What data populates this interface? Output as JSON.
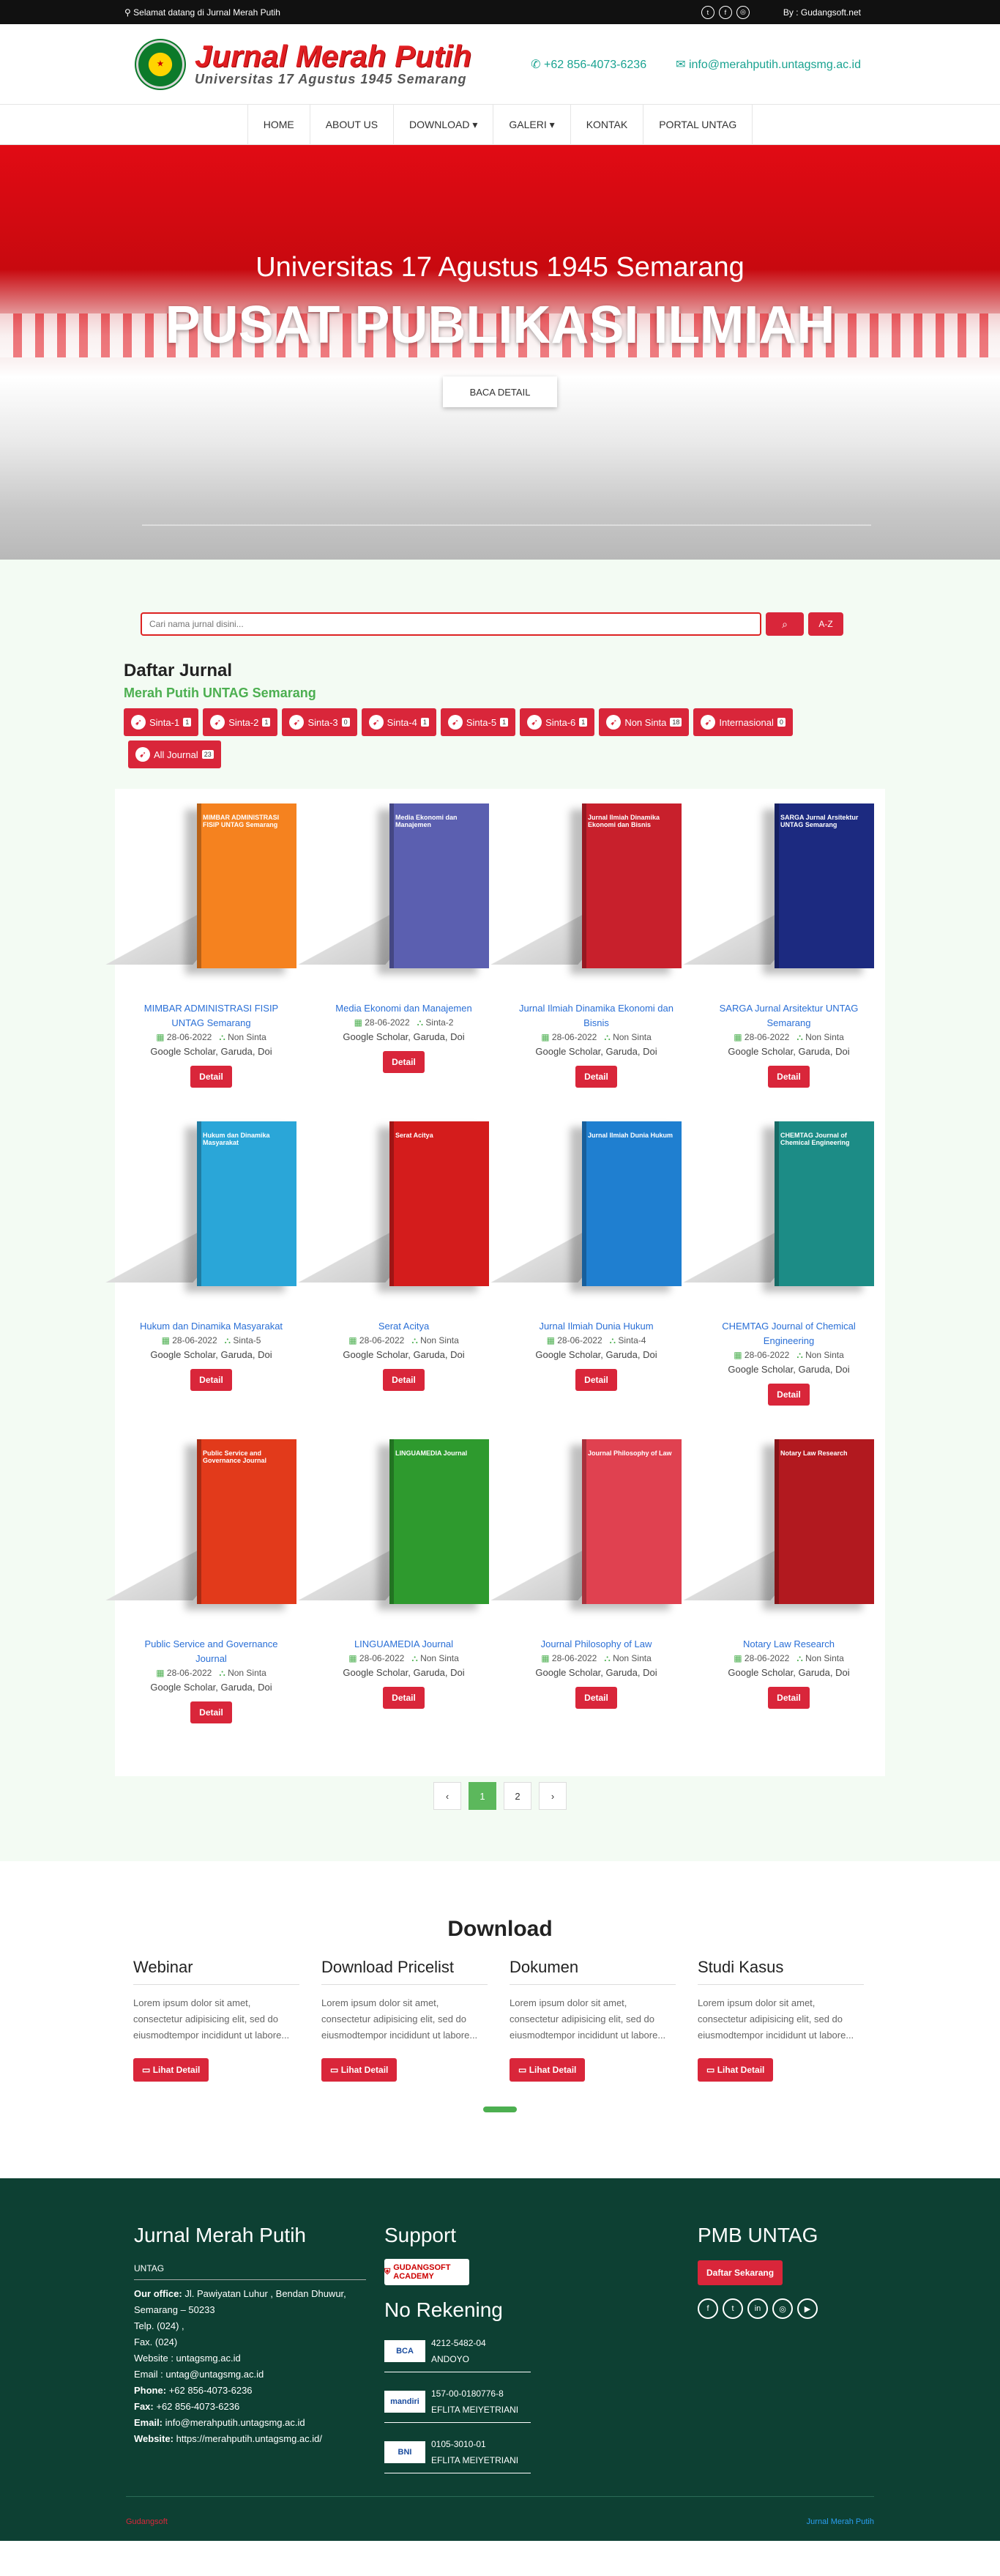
{
  "topbar": {
    "welcome": "Selamat datang di Jurnal Merah Putih",
    "credit": "By : Gudangsoft.net",
    "socials": [
      "twitter",
      "facebook",
      "instagram"
    ]
  },
  "header": {
    "title": "Jurnal Merah Putih",
    "subtitle": "Universitas 17 Agustus 1945 Semarang",
    "phone": "+62 856-4073-6236",
    "email": "info@merahputih.untagsmg.ac.id"
  },
  "nav": {
    "items": [
      "HOME",
      "ABOUT US",
      "DOWNLOAD ▾",
      "GALERI ▾",
      "KONTAK",
      "PORTAL UNTAG"
    ]
  },
  "hero": {
    "subtitle": "Universitas 17 Agustus 1945 Semarang",
    "title": "PUSAT PUBLIKASI ILMIAH",
    "button": "BACA DETAIL"
  },
  "search": {
    "placeholder": "Cari nama jurnal disini...",
    "az": "A-Z"
  },
  "list": {
    "title": "Daftar Jurnal",
    "subtitle": "Merah Putih UNTAG Semarang"
  },
  "filters": [
    {
      "label": "Sinta-1",
      "count": "1"
    },
    {
      "label": "Sinta-2",
      "count": "1"
    },
    {
      "label": "Sinta-3",
      "count": "0"
    },
    {
      "label": "Sinta-4",
      "count": "1"
    },
    {
      "label": "Sinta-5",
      "count": "1"
    },
    {
      "label": "Sinta-6",
      "count": "1"
    },
    {
      "label": "Non Sinta",
      "count": "18"
    },
    {
      "label": "Internasional",
      "count": "0"
    },
    {
      "label": "All Journal",
      "count": "23"
    }
  ],
  "journals": [
    {
      "name": "MIMBAR ADMINISTRASI FISIP UNTAG Semarang",
      "date": "28-06-2022",
      "sinta": "Non Sinta",
      "index": "Google Scholar, Garuda, Doi",
      "color": "#f5821f"
    },
    {
      "name": "Media Ekonomi dan Manajemen",
      "date": "28-06-2022",
      "sinta": "Sinta-2",
      "index": "Google Scholar, Garuda, Doi",
      "color": "#5b5fb0"
    },
    {
      "name": "Jurnal Ilmiah Dinamika Ekonomi dan Bisnis",
      "date": "28-06-2022",
      "sinta": "Non Sinta",
      "index": "Google Scholar, Garuda, Doi",
      "color": "#c8202c"
    },
    {
      "name": "SARGA Jurnal Arsitektur UNTAG Semarang",
      "date": "28-06-2022",
      "sinta": "Non Sinta",
      "index": "Google Scholar, Garuda, Doi",
      "color": "#1c2a80"
    },
    {
      "name": "Hukum dan Dinamika Masyarakat",
      "date": "28-06-2022",
      "sinta": "Sinta-5",
      "index": "Google Scholar, Garuda, Doi",
      "color": "#2aa6d8"
    },
    {
      "name": "Serat Acitya",
      "date": "28-06-2022",
      "sinta": "Non Sinta",
      "index": "Google Scholar, Garuda, Doi",
      "color": "#d41c1c"
    },
    {
      "name": "Jurnal Ilmiah Dunia Hukum",
      "date": "28-06-2022",
      "sinta": "Sinta-4",
      "index": "Google Scholar, Garuda, Doi",
      "color": "#1f7fd0"
    },
    {
      "name": "CHEMTAG Journal of Chemical Engineering",
      "date": "28-06-2022",
      "sinta": "Non Sinta",
      "index": "Google Scholar, Garuda, Doi",
      "color": "#1c8c86"
    },
    {
      "name": "Public Service and Governance Journal",
      "date": "28-06-2022",
      "sinta": "Non Sinta",
      "index": "Google Scholar, Garuda, Doi",
      "color": "#e23a1b"
    },
    {
      "name": "LINGUAMEDIA Journal",
      "date": "28-06-2022",
      "sinta": "Non Sinta",
      "index": "Google Scholar, Garuda, Doi",
      "color": "#2e9a2e"
    },
    {
      "name": "Journal Philosophy of Law",
      "date": "28-06-2022",
      "sinta": "Non Sinta",
      "index": "Google Scholar, Garuda, Doi",
      "color": "#e04150"
    },
    {
      "name": "Notary Law Research",
      "date": "28-06-2022",
      "sinta": "Non Sinta",
      "index": "Google Scholar, Garuda, Doi",
      "color": "#b2191f"
    }
  ],
  "detail_label": "Detail",
  "pagination": {
    "prev": "‹",
    "pages": [
      "1",
      "2"
    ],
    "next": "›",
    "active": "1"
  },
  "download": {
    "title": "Download",
    "button": "Lihat Detail",
    "items": [
      {
        "title": "Webinar",
        "text": "Lorem ipsum dolor sit amet, consectetur adipisicing elit, sed do eiusmodtempor incididunt ut labore..."
      },
      {
        "title": "Download Pricelist",
        "text": "Lorem ipsum dolor sit amet, consectetur adipisicing elit, sed do eiusmodtempor incididunt ut labore..."
      },
      {
        "title": "Dokumen",
        "text": "Lorem ipsum dolor sit amet, consectetur adipisicing elit, sed do eiusmodtempor incididunt ut labore..."
      },
      {
        "title": "Studi Kasus",
        "text": "Lorem ipsum dolor sit amet, consectetur adipisicing elit, sed do eiusmodtempor incididunt ut labore..."
      }
    ]
  },
  "footer": {
    "title": "Jurnal Merah Putih",
    "org": "UNTAG",
    "office_label": "Our office:",
    "office": "Jl. Pawiyatan Luhur , Bendan Dhuwur, Semarang – 50233",
    "telp": "Telp. (024) ,",
    "fax1": "Fax. (024)",
    "website1": "Website : untagsmg.ac.id",
    "email1": "Email : untag@untagsmg.ac.id",
    "phone_label": "Phone:",
    "phone": "+62 856-4073-6236",
    "fax_label": "Fax:",
    "fax": "+62 856-4073-6236",
    "email_label": "Email:",
    "email": "info@merahputih.untagsmg.ac.id",
    "website_label": "Website:",
    "website": "https://merahputih.untagsmg.ac.id/",
    "support_title": "Support",
    "support_logo": "GUDANGSOFT ACADEMY",
    "rekening_title": "No Rekening",
    "rekening": [
      {
        "bank": "BCA",
        "number": "4212-5482-04",
        "name": "ANDOYO"
      },
      {
        "bank": "mandiri",
        "number": "157-00-0180776-8",
        "name": "EFLITA MEIYETRIANI"
      },
      {
        "bank": "BNI",
        "number": "0105-3010-01",
        "name": "EFLITA MEIYETRIANI"
      }
    ],
    "pmb_title": "PMB UNTAG",
    "pmb_button": "Daftar Sekarang",
    "socials": [
      "facebook",
      "twitter",
      "linkedin",
      "instagram",
      "youtube"
    ],
    "bottom_left": "Gudangsoft",
    "bottom_right": "Jurnal Merah Putih"
  }
}
